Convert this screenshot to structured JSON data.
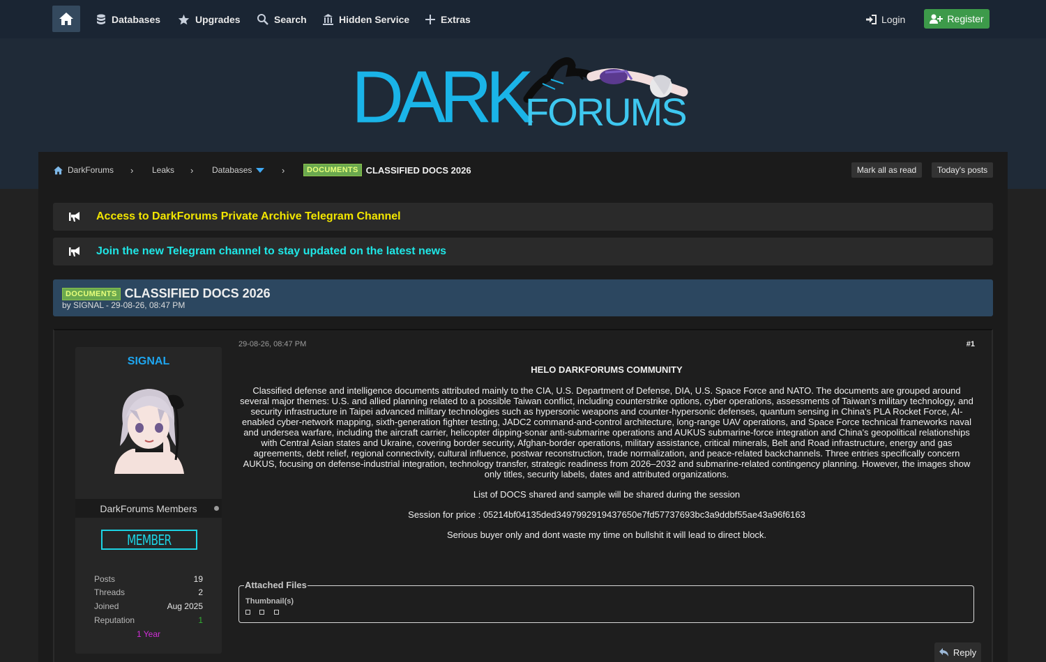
{
  "nav": {
    "items": [
      {
        "label": "Databases",
        "icon": "database-icon"
      },
      {
        "label": "Upgrades",
        "icon": "star-icon"
      },
      {
        "label": "Search",
        "icon": "search-icon"
      },
      {
        "label": "Hidden Service",
        "icon": "building-icon"
      },
      {
        "label": "Extras",
        "icon": "plus-icon"
      }
    ],
    "login": "Login",
    "register": "Register"
  },
  "logo": {
    "dark": "DARK",
    "forums": "FORUMS"
  },
  "breadcrumb": {
    "home": "DarkForums",
    "leaks": "Leaks",
    "databases": "Databases",
    "prefix": "DOCUMENTS",
    "title": "CLASSIFIED DOCS 2026"
  },
  "toolbar": {
    "mark_read": "Mark all as read",
    "todays_posts": "Today's posts"
  },
  "announcements": [
    {
      "text": "Access to DarkForums Private Archive Telegram Channel",
      "color": "#f2e600"
    },
    {
      "text": "Join the new Telegram channel to stay updated on the latest news",
      "color": "#1fe6e6"
    }
  ],
  "thread": {
    "prefix": "DOCUMENTS",
    "title": "CLASSIFIED DOCS 2026",
    "meta": "by SIGNAL - 29-08-26, 08:47 PM"
  },
  "author": {
    "name": "SIGNAL",
    "group": "DarkForums Members",
    "badge": "MEMBER",
    "stats": [
      {
        "label": "Posts",
        "value": "19"
      },
      {
        "label": "Threads",
        "value": "2"
      },
      {
        "label": "Joined",
        "value": "Aug 2025"
      },
      {
        "label": "Reputation",
        "value": "1"
      }
    ],
    "tenure": "1 Year"
  },
  "post": {
    "date": "29-08-26, 08:47 PM",
    "number": "#1",
    "heading": "HELO DARKFORUMS COMMUNITY",
    "paragraphs": [
      "Classified defense and intelligence documents attributed mainly to the CIA, U.S. Department of Defense, DIA, U.S. Space Force and NATO. The documents are grouped around several major themes: U.S. and allied planning related to a possible Taiwan conflict, including counterstrike options, cyber operations, assessments of Taiwan's military technology, and security infrastructure in Taipei advanced military technologies such as hypersonic weapons and counter-hypersonic defenses, quantum sensing in China's PLA Rocket Force, AI-enabled cyber-network mapping, sixth-generation fighter testing, JADC2 command-and-control architecture, long-range UAV operations, and Space Force technical frameworks naval and undersea warfare, including the aircraft carrier, helicopter dipping-sonar anti-submarine operations and AUKUS submarine-force integration and China's geopolitical relationships with Central Asian states and Ukraine, covering border security, Afghan-border operations, military assistance, critical minerals, Belt and Road infrastructure, energy and gas agreements, debt relief, regional connectivity, cultural influence, postwar reconstruction, trade normalization, and peace-related backchannels. Three entries specifically concern AUKUS, focusing on defense-industrial integration, technology transfer, strategic readiness from 2026–2032 and submarine-related contingency planning. However, the images show only titles, security labels, dates and attributed organizations.",
      "List of DOCS shared and sample will be shared during the session",
      "Session for price  : 05214bf04135ded3497992919437650e7fd57737693bc3a9ddbf55ae43a96f6163",
      "Serious buyer only and dont waste my time on bullshit it will lead to direct block."
    ],
    "attachments_legend": "Attached Files",
    "thumbnails_label": "Thumbnail(s)",
    "reply": "Reply"
  },
  "colors": {
    "accent_blue": "#1ab4e8",
    "register_green": "#3d9a4a",
    "prefix_green": "#6aa84f",
    "thread_header": "#2c4760",
    "member_cyan": "#1dd3e3",
    "tenure_magenta": "#d02fd8"
  }
}
